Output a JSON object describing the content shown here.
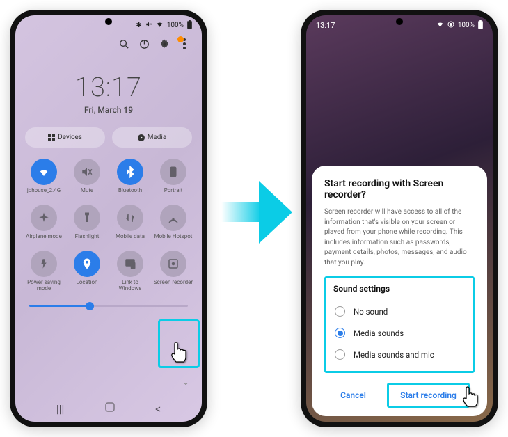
{
  "status_left": {
    "bluetooth": "✱",
    "mute": true,
    "wifi": true,
    "battery_pct": "100%"
  },
  "status_right": {
    "time": "13:17",
    "wifi": true,
    "battery_pct": "100%"
  },
  "clock": {
    "time": "13:17",
    "date": "Fri, March 19"
  },
  "pills": {
    "devices": "Devices",
    "media": "Media"
  },
  "qs": [
    {
      "label": "jbhouse_2.4G",
      "icon": "wifi",
      "active": true
    },
    {
      "label": "Mute",
      "icon": "mute",
      "active": false
    },
    {
      "label": "Bluetooth",
      "icon": "bluetooth",
      "active": true
    },
    {
      "label": "Portrait",
      "icon": "portrait",
      "active": false
    },
    {
      "label": "Airplane mode",
      "icon": "airplane",
      "active": false
    },
    {
      "label": "Flashlight",
      "icon": "flashlight",
      "active": false
    },
    {
      "label": "Mobile data",
      "icon": "mobiledata",
      "active": false
    },
    {
      "label": "Mobile Hotspot",
      "icon": "hotspot",
      "active": false
    },
    {
      "label": "Power saving mode",
      "icon": "power",
      "active": false
    },
    {
      "label": "Location",
      "icon": "location",
      "active": true
    },
    {
      "label": "Link to Windows",
      "icon": "link",
      "active": false
    },
    {
      "label": "Screen recorder",
      "icon": "record",
      "active": false
    }
  ],
  "brightness_pct": 38,
  "dialog": {
    "title": "Start recording with Screen recorder?",
    "body": "Screen recorder will have access to all of the information that's visible on your screen or played from your phone while recording. This includes information such as passwords, payment details, photos, messages, and audio that you play.",
    "sound_title": "Sound settings",
    "options": [
      {
        "label": "No sound",
        "checked": false
      },
      {
        "label": "Media sounds",
        "checked": true
      },
      {
        "label": "Media sounds and mic",
        "checked": false
      }
    ],
    "cancel": "Cancel",
    "start": "Start recording"
  }
}
